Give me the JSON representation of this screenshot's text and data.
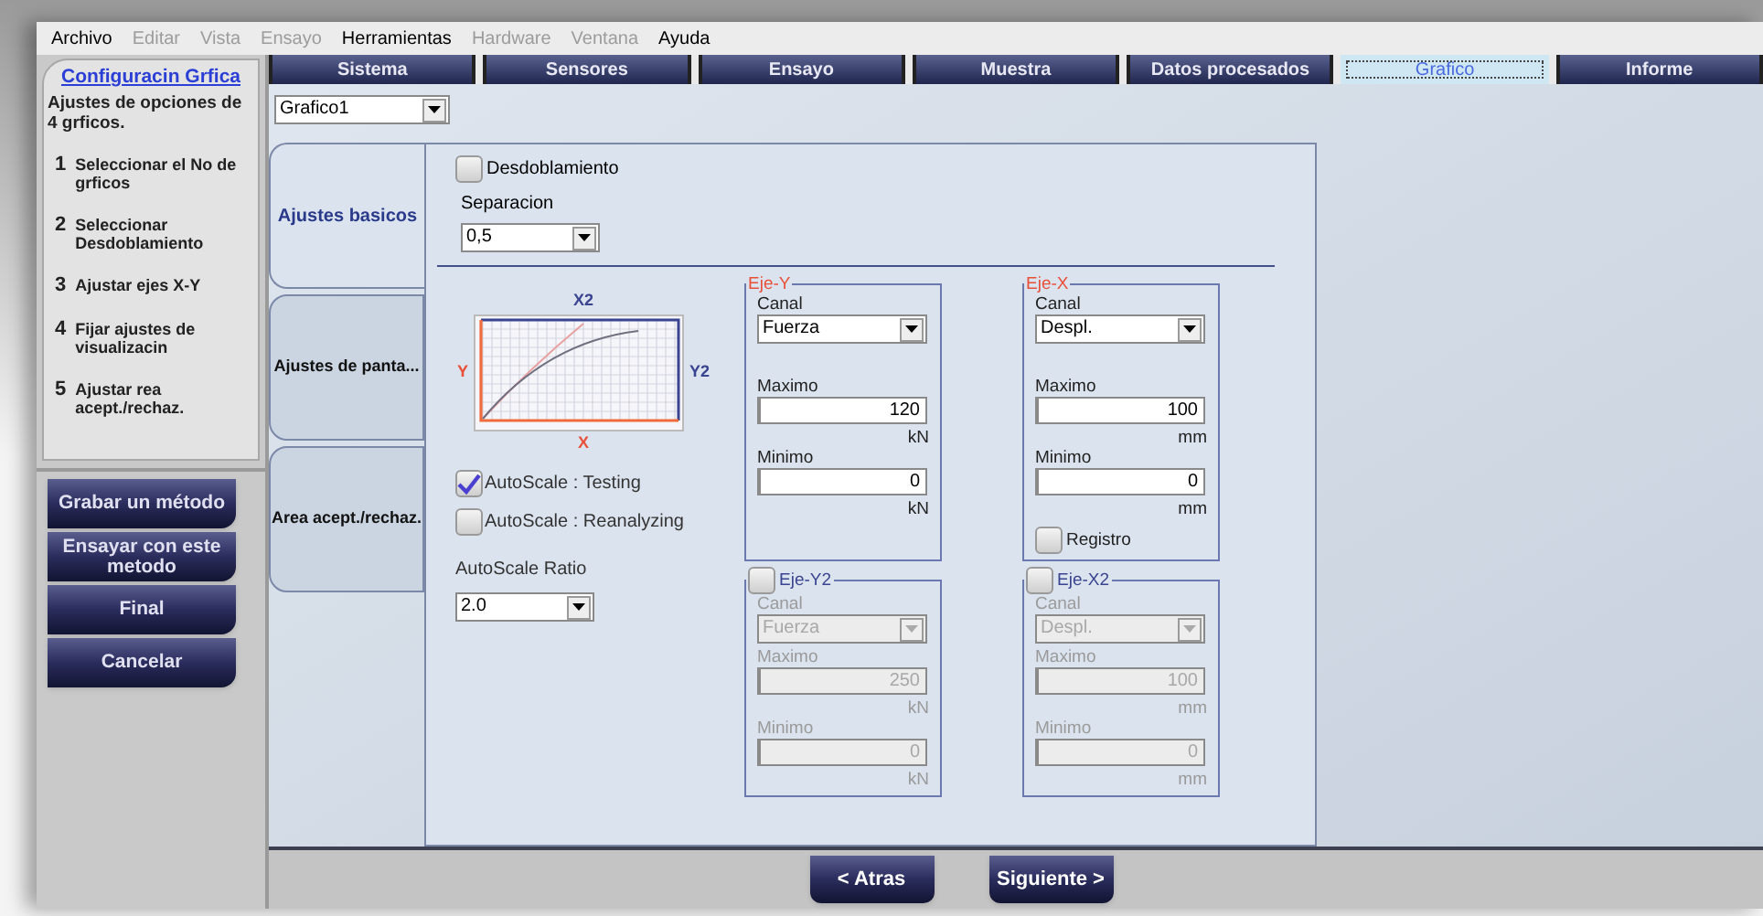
{
  "menu": [
    {
      "label": "Archivo",
      "disabled": false
    },
    {
      "label": "Editar",
      "disabled": true
    },
    {
      "label": "Vista",
      "disabled": true
    },
    {
      "label": "Ensayo",
      "disabled": true
    },
    {
      "label": "Herramientas",
      "disabled": false
    },
    {
      "label": "Hardware",
      "disabled": true
    },
    {
      "label": "Ventana",
      "disabled": true
    },
    {
      "label": "Ayuda",
      "disabled": false
    }
  ],
  "sidebar": {
    "title": "Configuracin Grfica",
    "description": "Ajustes de opciones de 4 grficos.",
    "steps": [
      {
        "number": "1",
        "text": "Seleccionar el No de grficos"
      },
      {
        "number": "2",
        "text": "Seleccionar Desdoblamiento"
      },
      {
        "number": "3",
        "text": "Ajustar ejes X-Y"
      },
      {
        "number": "4",
        "text": "Fijar ajustes de visualizacin"
      },
      {
        "number": "5",
        "text": "Ajustar rea acept./rechaz."
      }
    ],
    "buttons": [
      "Grabar un método",
      "Ensayar con este metodo",
      "Final",
      "Cancelar"
    ]
  },
  "tabs": [
    {
      "label": "Sistema",
      "selected": false
    },
    {
      "label": "Sensores",
      "selected": false
    },
    {
      "label": "Ensayo",
      "selected": false
    },
    {
      "label": "Muestra",
      "selected": false
    },
    {
      "label": "Datos procesados",
      "selected": false
    },
    {
      "label": "Grafico",
      "selected": true
    },
    {
      "label": "Informe",
      "selected": false
    }
  ],
  "graph_select": {
    "value": "Grafico1"
  },
  "side_tabs": [
    {
      "label": "Ajustes basicos",
      "selected": true
    },
    {
      "label": "Ajustes de panta...",
      "selected": false
    },
    {
      "label": "Area acept./rechaz.",
      "selected": false
    }
  ],
  "desdoblamiento": {
    "label": "Desdoblamiento",
    "checked": false
  },
  "separacion": {
    "label": "Separacion",
    "value": "0,5"
  },
  "preview": {
    "top": "X2",
    "left": "Y",
    "right": "Y2",
    "bottom": "X"
  },
  "autoscale": [
    {
      "label": "AutoScale : Testing",
      "checked": true
    },
    {
      "label": "AutoScale : Reanalyzing",
      "checked": false
    }
  ],
  "ratio": {
    "label": "AutoScale Ratio",
    "value": "2.0"
  },
  "axes": [
    {
      "kind": "fixed",
      "title": "Eje-Y",
      "disabled": false,
      "canal_label": "Canal",
      "canal": "Fuerza",
      "max_label": "Maximo",
      "max": "120",
      "max_unit": "kN",
      "min_label": "Minimo",
      "min": "0",
      "min_unit": "kN"
    },
    {
      "kind": "fixed",
      "title": "Eje-X",
      "disabled": false,
      "canal_label": "Canal",
      "canal": "Despl.",
      "max_label": "Maximo",
      "max": "100",
      "max_unit": "mm",
      "min_label": "Minimo",
      "min": "0",
      "min_unit": "mm",
      "registro": {
        "label": "Registro",
        "checked": false
      }
    },
    {
      "kind": "optional",
      "title": "Eje-Y2",
      "checked": false,
      "disabled": true,
      "canal_label": "Canal",
      "canal": "Fuerza",
      "max_label": "Maximo",
      "max": "250",
      "max_unit": "kN",
      "min_label": "Minimo",
      "min": "0",
      "min_unit": "kN"
    },
    {
      "kind": "optional",
      "title": "Eje-X2",
      "checked": false,
      "disabled": true,
      "canal_label": "Canal",
      "canal": "Despl.",
      "max_label": "Maximo",
      "max": "100",
      "max_unit": "mm",
      "min_label": "Minimo",
      "min": "0",
      "min_unit": "mm"
    }
  ],
  "nav": [
    "< Atras",
    "Siguiente >"
  ]
}
